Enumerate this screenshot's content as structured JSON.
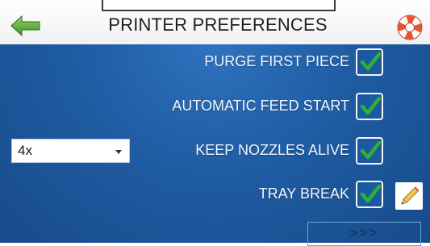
{
  "header": {
    "title": "PRINTER PREFERENCES",
    "back_icon": "back-arrow-icon",
    "help_icon": "lifebuoy-help-icon"
  },
  "options": [
    {
      "label": "PURGE FIRST PIECE",
      "checked": true
    },
    {
      "label": "AUTOMATIC FEED START",
      "checked": true
    },
    {
      "label": "KEEP NOZZLES ALIVE",
      "checked": true
    },
    {
      "label": "TRAY BREAK",
      "checked": true
    }
  ],
  "select": {
    "value": "4x"
  },
  "next_button": {
    "label": ">>>"
  },
  "colors": {
    "background": "#1f5ca3",
    "check": "#2fb12f",
    "arrow": "#5aa83a",
    "help": "#e4572e"
  }
}
